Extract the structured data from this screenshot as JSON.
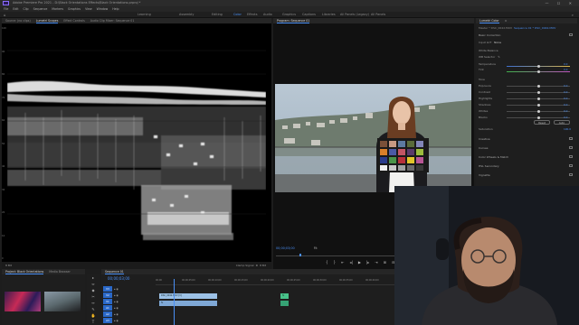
{
  "app": {
    "title": "Adobe Premiere Pro 2021 - D:\\Black Orientations Effects\\Black Orientations.prproj *",
    "window_controls": "—  ☐  ✕"
  },
  "menu": [
    "File",
    "Edit",
    "Clip",
    "Sequence",
    "Markers",
    "Graphics",
    "View",
    "Window",
    "Help"
  ],
  "workspaces": {
    "items": [
      "Learning",
      "Assembly",
      "Editing",
      "Color",
      "Effects",
      "Audio",
      "Graphics",
      "Captions",
      "Libraries",
      "All Panels (Legacy)",
      "All Panels"
    ],
    "active": "Color"
  },
  "source_panel": {
    "tabs": [
      "Source: (no clips)",
      "Lumetri Scopes",
      "Effect Controls",
      "Audio Clip Mixer: Sequence 01"
    ],
    "active_tab": "Lumetri Scopes",
    "scale_labels": [
      "100",
      "90",
      "80",
      "70",
      "60",
      "50",
      "40",
      "30",
      "20",
      "10",
      "0"
    ],
    "footer_left": "8 Bit",
    "footer_right": "8 Bit",
    "clamp_label": "Clamp Signal"
  },
  "program_panel": {
    "tabs": [
      "Program: Sequence 01"
    ],
    "active_tab": "Program: Sequence 01",
    "timecode": "00;00;03;00",
    "fit": "Fit",
    "transport": [
      "{",
      "}",
      "⇤",
      "◂|",
      "▶",
      "|▸",
      "⇥",
      "⊞",
      "⊟",
      "◎",
      "+"
    ]
  },
  "lumetri": {
    "tabs": [
      "Lumetri Color",
      "≡"
    ],
    "active_tab": "Lumetri Color",
    "master": "Master * DSC_0042.MOV",
    "clip": "Sequence 01 * DSC_0042.MOV",
    "section_basic": "Basic Correction",
    "input_lut_label": "Input LUT",
    "input_lut_value": "None",
    "white_balance": "White Balance",
    "wb_selector": "WB Selector",
    "tone": "Tone",
    "rows": [
      {
        "label": "Temperature",
        "value": "0.0",
        "pos": 0.5
      },
      {
        "label": "Tint",
        "value": "0.0",
        "pos": 0.5
      },
      {
        "label": "Exposure",
        "value": "0.0",
        "pos": 0.5
      },
      {
        "label": "Contrast",
        "value": "0.0",
        "pos": 0.5
      },
      {
        "label": "Highlights",
        "value": "0.0",
        "pos": 0.5
      },
      {
        "label": "Shadows",
        "value": "0.0",
        "pos": 0.5
      },
      {
        "label": "Whites",
        "value": "0.0",
        "pos": 0.5
      },
      {
        "label": "Blacks",
        "value": "0.0",
        "pos": 0.5
      }
    ],
    "reset_label": "Reset",
    "auto_label": "Auto",
    "saturation_label": "Saturation",
    "saturation_value": "100.0",
    "sections": [
      "Creative",
      "Curves",
      "Color Wheels & Match",
      "HSL Secondary",
      "Vignette"
    ]
  },
  "project_panel": {
    "tabs": [
      "Project: Black Orientations",
      "Media Browser"
    ],
    "active_tab": "Project: Black Orientations"
  },
  "tools": [
    "▸",
    "⇔",
    "◆",
    "✂",
    "↔",
    "✎",
    "✋",
    "T"
  ],
  "timeline": {
    "tab": "Sequence 01",
    "timecode": "00;00;03;00",
    "ruler": [
      "00;00",
      "00;00;05;00",
      "00;00;10;00",
      "00;00;15;00",
      "00;00;20;00",
      "00;00;25;00",
      "00;00;30;00",
      "00;00;35;00",
      "00;00;40;00"
    ],
    "tracks": [
      "V3",
      "V2",
      "V1",
      "A1",
      "A2",
      "A3"
    ],
    "clips": [
      "DSC_0042.MOV [V]",
      "fx",
      "fx"
    ]
  },
  "colors": {
    "accent": "#4a8ff5",
    "clip_video": "#9cc1e6",
    "clip_audio": "#48c28a"
  }
}
